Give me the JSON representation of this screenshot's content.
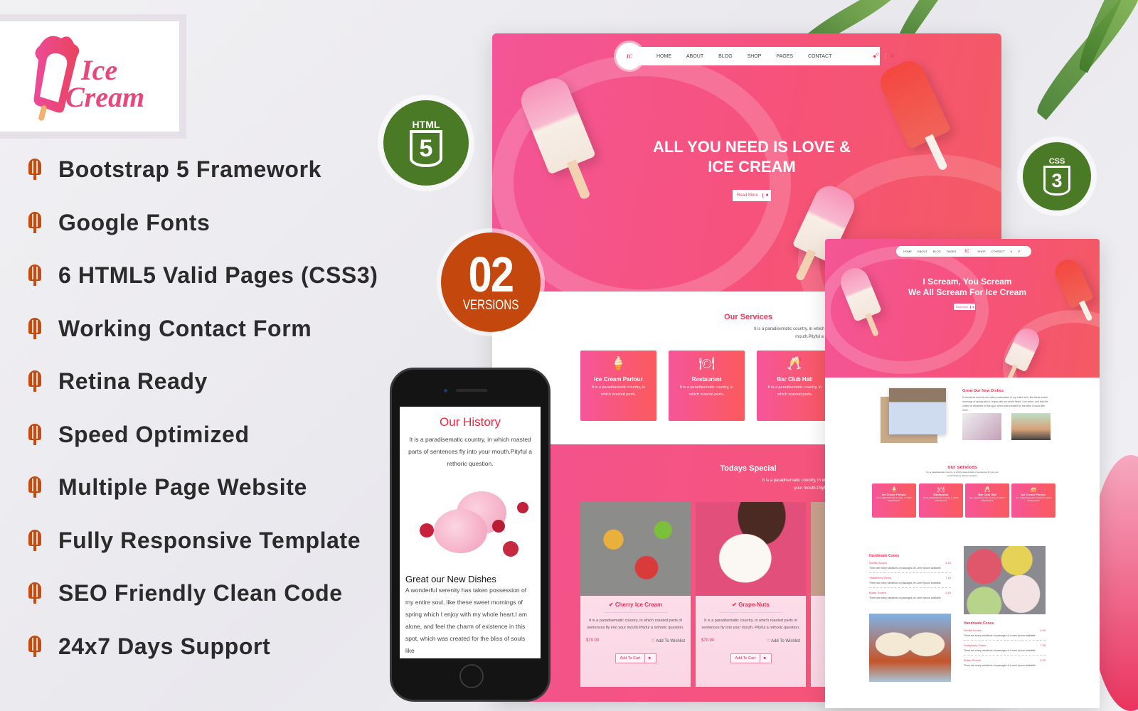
{
  "brand": {
    "logo_text_line1": "Ice",
    "logo_text_line2": "Cream",
    "accent": "#f2355a",
    "pink": "#f6559a",
    "badge_green": "#4a7a26",
    "badge_orange": "#c4470d"
  },
  "features": [
    "Bootstrap 5 Framework",
    "Google Fonts",
    "6 HTML5 Valid Pages (CSS3)",
    "Working Contact Form",
    "Retina Ready",
    "Speed Optimized",
    "Multiple Page Website",
    "Fully Responsive Template",
    "SEO Friendly Clean Code",
    "24x7 Days Support"
  ],
  "badges": {
    "html": "HTML",
    "html_num": "5",
    "css": "CSS",
    "css_num": "3",
    "versions_num": "02",
    "versions_label": "VERSIONS"
  },
  "desktop1": {
    "nav": [
      "HOME",
      "ABOUT",
      "BLOG",
      "SHOP",
      "PAGES",
      "CONTACT"
    ],
    "cart_count": "0",
    "hero_title_1": "ALL YOU NEED IS LOVE &",
    "hero_title_2": "ICE CREAM",
    "read_more": "Read More",
    "services_title": "Our Services",
    "services_sub_1": "It is a paradisematic country, in which roasted parts of sentences fly into your",
    "services_sub_2": "mouth.Pityful a rethoric question.",
    "services": [
      {
        "title": "Ice Cream Parlour",
        "desc": "It is a paradisematic country, in which roasted parts.",
        "icon": "ice-cream-icon"
      },
      {
        "title": "Restaurant",
        "desc": "It is a paradisematic country, in which roasted parts.",
        "icon": "plate-cutlery-icon"
      },
      {
        "title": "Bar Club Hall",
        "desc": "It is a paradisematic country, in which roasted parts.",
        "icon": "wine-glasses-icon"
      }
    ],
    "special_title": "Todays Special",
    "special_sub_1": "It is a paradisematic country, in which roasted parts of sentences fly into",
    "special_sub_2": "your mouth.Pityful a rethoric question.",
    "products": [
      {
        "name": "Cherry Ice Cream",
        "desc": "It is a paradisematic country, in which roasted parts of sentences fly into your mouth.Pityful a rethoric question.",
        "price": "$70.00",
        "wishlist": "Add To Wishlist",
        "cart": "Add To Cart"
      },
      {
        "name": "Grape-Nuts",
        "desc": "It is a paradisematic country, in which roasted parts of sentences fly into your mouth. Pityful a rethoric question.",
        "price": "$70.00",
        "wishlist": "Add To Wishlist",
        "cart": "Add To Cart"
      }
    ]
  },
  "desktop2": {
    "nav_left": [
      "HOME",
      "ABOUT",
      "BLOG",
      "PAGES"
    ],
    "nav_right": [
      "SHOP",
      "CONTACT"
    ],
    "hero_title_1": "I Scream, You Scream",
    "hero_title_2": "We All Scream For Ice Cream",
    "read_more": "Read More",
    "dishes_title": "Great Our New Dishes",
    "dishes_text": "A wonderful serenity has taken possession of my entire soul, like these sweet mornings of spring which I enjoy with my whole heart. I am alone, and feel the charm of existence in this spot, which was created for the bliss of souls like mine.",
    "services_title": "our services",
    "services_sub": "It is a paradisematic country, in which roasted parts of sentences fly into your mouth.Pityful a rethoric question.",
    "services": [
      {
        "title": "Ice Cream Parlour",
        "desc": "It is a paradisematic country, in which roasted parts."
      },
      {
        "title": "Restaurant",
        "desc": "It is a paradisematic country, in which roasted parts."
      },
      {
        "title": "Bar Club Hall",
        "desc": "It is a paradisematic country, in which roasted parts."
      },
      {
        "title": "Ice Cream Parlour",
        "desc": "It is a paradisematic country, in which roasted parts."
      }
    ],
    "menu1_title": "Handmade Cones",
    "menu1": [
      {
        "name": "Vanilla Scotch",
        "price": "6.15",
        "desc": "There are many variations of passages of Lorem Ipsum available."
      },
      {
        "name": "Strawberry Gems",
        "price": "7.15",
        "desc": "There are many variations of passages of Lorem Ipsum available."
      },
      {
        "name": "Butter Scotch",
        "price": "9.15",
        "desc": "There are many variations of passages of Lorem Ipsum available."
      }
    ],
    "menu2_title": "Handmade Cones",
    "menu2": [
      {
        "name": "Vanilla Scotch",
        "price": "6.55",
        "desc": "There are many variations of passages of Lorem Ipsum available."
      },
      {
        "name": "Strawberry Gems",
        "price": "7.55",
        "desc": "There are many variations of passages of Lorem Ipsum available."
      },
      {
        "name": "Butter Scotch",
        "price": "9.55",
        "desc": "There are many variations of passages of Lorem Ipsum available."
      }
    ]
  },
  "mobile": {
    "history_title": "Our History",
    "history_text": "It is a paradisematic country, in which roasted parts of sentences fly into your mouth.Pityful a rethoric question.",
    "dishes_title": "Great our New Dishes",
    "dishes_text": "A wonderful serenity has taken possession of my entire soul, like these sweet mornings of spring which I enjoy with my whole heart.I am alone, and feel the charm of existence in this spot, which was created for the bliss of souls like"
  }
}
